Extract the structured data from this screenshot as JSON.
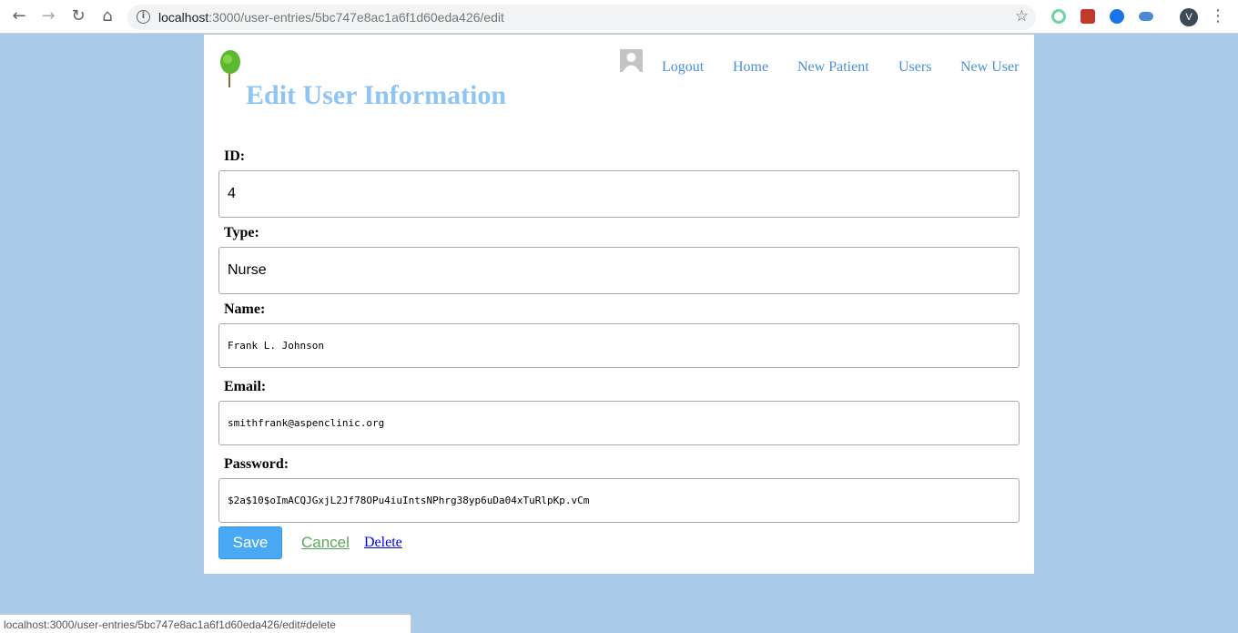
{
  "browser": {
    "url_host": "localhost",
    "url_rest": ":3000/user-entries/5bc747e8ac1a6f1d60eda426/edit",
    "profile_initial": "V",
    "status_url": "localhost:3000/user-entries/5bc747e8ac1a6f1d60eda426/edit#delete"
  },
  "header": {
    "title": "Edit User Information",
    "nav": [
      "Logout",
      "Home",
      "New Patient",
      "Users",
      "New User"
    ]
  },
  "form": {
    "fields": [
      {
        "label": "ID:",
        "value": "4"
      },
      {
        "label": "Type:",
        "value": "Nurse"
      },
      {
        "label": "Name:",
        "value": "Frank L. Johnson"
      },
      {
        "label": "Email:",
        "value": "smithfrank@aspenclinic.org"
      },
      {
        "label": "Password:",
        "value": "$2a$10$oImACQJGxjL2Jf78OPu4iuIntsNPhrg38yp6uDa04xTuRlpKp.vCm"
      }
    ],
    "save_label": "Save",
    "cancel_label": "Cancel",
    "delete_label": "Delete"
  }
}
